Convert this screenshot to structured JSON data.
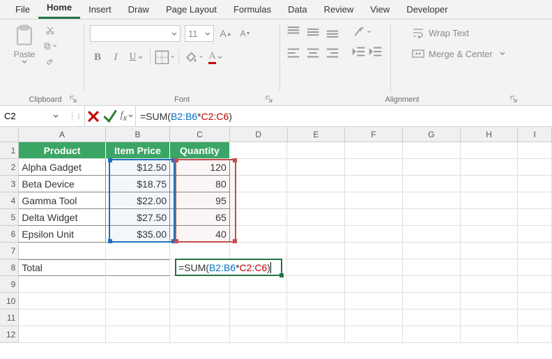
{
  "tabs": [
    "File",
    "Home",
    "Insert",
    "Draw",
    "Page Layout",
    "Formulas",
    "Data",
    "Review",
    "View",
    "Developer"
  ],
  "activeTab": "Home",
  "clipboard": {
    "paste": "Paste",
    "label": "Clipboard"
  },
  "font": {
    "label": "Font",
    "size": "11"
  },
  "alignment": {
    "label": "Alignment",
    "wrap": "Wrap Text",
    "merge": "Merge & Center"
  },
  "namebox": "C2",
  "formula": {
    "prefix": "=SUM(",
    "r1": "B2:B6",
    "op": "*",
    "r2": "C2:C6",
    "suffix": ")",
    "full": "=SUM(B2:B6*C2:C6)"
  },
  "columns": [
    "A",
    "B",
    "C",
    "D",
    "E",
    "F",
    "G",
    "H",
    "I"
  ],
  "rows": [
    "1",
    "2",
    "3",
    "4",
    "5",
    "6",
    "7",
    "8",
    "9",
    "10",
    "11",
    "12"
  ],
  "headers": {
    "A": "Product",
    "B": "Item Price",
    "C": "Quantity"
  },
  "data": [
    {
      "product": "Alpha Gadget",
      "price": "$12.50",
      "qty": "120"
    },
    {
      "product": "Beta Device",
      "price": "$18.75",
      "qty": "80"
    },
    {
      "product": "Gamma Tool",
      "price": "$22.00",
      "qty": "95"
    },
    {
      "product": "Delta Widget",
      "price": "$27.50",
      "qty": "65"
    },
    {
      "product": "Epsilon Unit",
      "price": "$35.00",
      "qty": "40"
    }
  ],
  "totalLabel": "Total"
}
